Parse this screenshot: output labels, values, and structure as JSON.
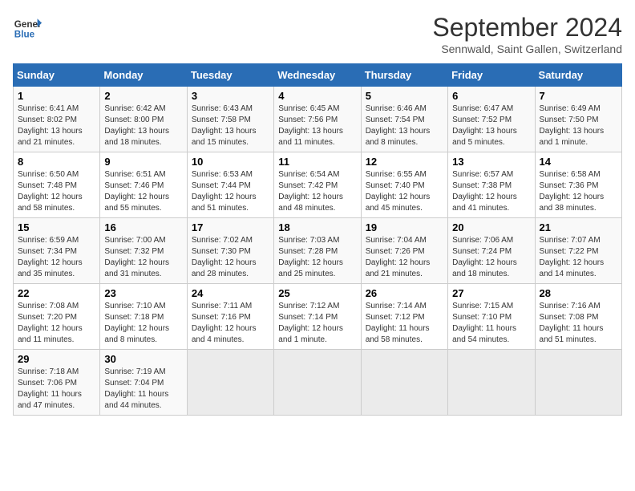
{
  "header": {
    "logo_line1": "General",
    "logo_line2": "Blue",
    "month": "September 2024",
    "location": "Sennwald, Saint Gallen, Switzerland"
  },
  "weekdays": [
    "Sunday",
    "Monday",
    "Tuesday",
    "Wednesday",
    "Thursday",
    "Friday",
    "Saturday"
  ],
  "weeks": [
    [
      {
        "day": "1",
        "detail": "Sunrise: 6:41 AM\nSunset: 8:02 PM\nDaylight: 13 hours\nand 21 minutes."
      },
      {
        "day": "2",
        "detail": "Sunrise: 6:42 AM\nSunset: 8:00 PM\nDaylight: 13 hours\nand 18 minutes."
      },
      {
        "day": "3",
        "detail": "Sunrise: 6:43 AM\nSunset: 7:58 PM\nDaylight: 13 hours\nand 15 minutes."
      },
      {
        "day": "4",
        "detail": "Sunrise: 6:45 AM\nSunset: 7:56 PM\nDaylight: 13 hours\nand 11 minutes."
      },
      {
        "day": "5",
        "detail": "Sunrise: 6:46 AM\nSunset: 7:54 PM\nDaylight: 13 hours\nand 8 minutes."
      },
      {
        "day": "6",
        "detail": "Sunrise: 6:47 AM\nSunset: 7:52 PM\nDaylight: 13 hours\nand 5 minutes."
      },
      {
        "day": "7",
        "detail": "Sunrise: 6:49 AM\nSunset: 7:50 PM\nDaylight: 13 hours\nand 1 minute."
      }
    ],
    [
      {
        "day": "8",
        "detail": "Sunrise: 6:50 AM\nSunset: 7:48 PM\nDaylight: 12 hours\nand 58 minutes."
      },
      {
        "day": "9",
        "detail": "Sunrise: 6:51 AM\nSunset: 7:46 PM\nDaylight: 12 hours\nand 55 minutes."
      },
      {
        "day": "10",
        "detail": "Sunrise: 6:53 AM\nSunset: 7:44 PM\nDaylight: 12 hours\nand 51 minutes."
      },
      {
        "day": "11",
        "detail": "Sunrise: 6:54 AM\nSunset: 7:42 PM\nDaylight: 12 hours\nand 48 minutes."
      },
      {
        "day": "12",
        "detail": "Sunrise: 6:55 AM\nSunset: 7:40 PM\nDaylight: 12 hours\nand 45 minutes."
      },
      {
        "day": "13",
        "detail": "Sunrise: 6:57 AM\nSunset: 7:38 PM\nDaylight: 12 hours\nand 41 minutes."
      },
      {
        "day": "14",
        "detail": "Sunrise: 6:58 AM\nSunset: 7:36 PM\nDaylight: 12 hours\nand 38 minutes."
      }
    ],
    [
      {
        "day": "15",
        "detail": "Sunrise: 6:59 AM\nSunset: 7:34 PM\nDaylight: 12 hours\nand 35 minutes."
      },
      {
        "day": "16",
        "detail": "Sunrise: 7:00 AM\nSunset: 7:32 PM\nDaylight: 12 hours\nand 31 minutes."
      },
      {
        "day": "17",
        "detail": "Sunrise: 7:02 AM\nSunset: 7:30 PM\nDaylight: 12 hours\nand 28 minutes."
      },
      {
        "day": "18",
        "detail": "Sunrise: 7:03 AM\nSunset: 7:28 PM\nDaylight: 12 hours\nand 25 minutes."
      },
      {
        "day": "19",
        "detail": "Sunrise: 7:04 AM\nSunset: 7:26 PM\nDaylight: 12 hours\nand 21 minutes."
      },
      {
        "day": "20",
        "detail": "Sunrise: 7:06 AM\nSunset: 7:24 PM\nDaylight: 12 hours\nand 18 minutes."
      },
      {
        "day": "21",
        "detail": "Sunrise: 7:07 AM\nSunset: 7:22 PM\nDaylight: 12 hours\nand 14 minutes."
      }
    ],
    [
      {
        "day": "22",
        "detail": "Sunrise: 7:08 AM\nSunset: 7:20 PM\nDaylight: 12 hours\nand 11 minutes."
      },
      {
        "day": "23",
        "detail": "Sunrise: 7:10 AM\nSunset: 7:18 PM\nDaylight: 12 hours\nand 8 minutes."
      },
      {
        "day": "24",
        "detail": "Sunrise: 7:11 AM\nSunset: 7:16 PM\nDaylight: 12 hours\nand 4 minutes."
      },
      {
        "day": "25",
        "detail": "Sunrise: 7:12 AM\nSunset: 7:14 PM\nDaylight: 12 hours\nand 1 minute."
      },
      {
        "day": "26",
        "detail": "Sunrise: 7:14 AM\nSunset: 7:12 PM\nDaylight: 11 hours\nand 58 minutes."
      },
      {
        "day": "27",
        "detail": "Sunrise: 7:15 AM\nSunset: 7:10 PM\nDaylight: 11 hours\nand 54 minutes."
      },
      {
        "day": "28",
        "detail": "Sunrise: 7:16 AM\nSunset: 7:08 PM\nDaylight: 11 hours\nand 51 minutes."
      }
    ],
    [
      {
        "day": "29",
        "detail": "Sunrise: 7:18 AM\nSunset: 7:06 PM\nDaylight: 11 hours\nand 47 minutes."
      },
      {
        "day": "30",
        "detail": "Sunrise: 7:19 AM\nSunset: 7:04 PM\nDaylight: 11 hours\nand 44 minutes."
      },
      {
        "day": "",
        "detail": ""
      },
      {
        "day": "",
        "detail": ""
      },
      {
        "day": "",
        "detail": ""
      },
      {
        "day": "",
        "detail": ""
      },
      {
        "day": "",
        "detail": ""
      }
    ]
  ]
}
